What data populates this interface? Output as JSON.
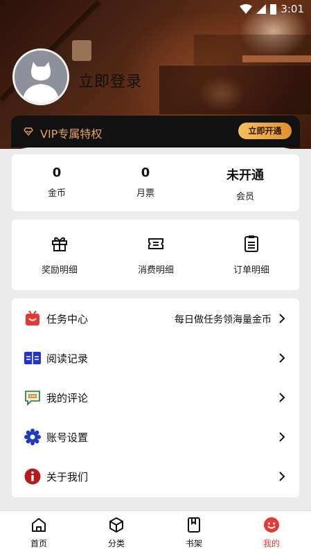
{
  "status_bar": {
    "time": "3:01"
  },
  "profile": {
    "login_label": "立即登录"
  },
  "vip": {
    "label": "VIP专属特权",
    "button": "立即开通"
  },
  "stats": [
    {
      "value": "0",
      "label": "金币"
    },
    {
      "value": "0",
      "label": "月票"
    },
    {
      "value": "未开通",
      "label": "会员"
    }
  ],
  "details": [
    {
      "label": "奖励明细",
      "icon": "gift-icon"
    },
    {
      "label": "消费明细",
      "icon": "ticket-icon"
    },
    {
      "label": "订单明细",
      "icon": "order-list-icon"
    }
  ],
  "menu": [
    {
      "label": "任务中心",
      "hint": "每日做任务领海量金币",
      "icon": "tv-task-icon"
    },
    {
      "label": "阅读记录",
      "hint": "",
      "icon": "book-open-icon"
    },
    {
      "label": "我的评论",
      "hint": "",
      "icon": "comment-icon"
    },
    {
      "label": "账号设置",
      "hint": "",
      "icon": "gear-icon"
    },
    {
      "label": "关于我们",
      "hint": "",
      "icon": "info-icon"
    }
  ],
  "nav": [
    {
      "label": "首页",
      "icon": "home-icon"
    },
    {
      "label": "分类",
      "icon": "cube-icon"
    },
    {
      "label": "书架",
      "icon": "bookshelf-icon"
    },
    {
      "label": "我的",
      "icon": "smile-face-icon"
    }
  ],
  "colors": {
    "accent": "#e53935",
    "vip_gold": "#e8a15a",
    "vip_button": "#f0a840",
    "background": "#ececec"
  }
}
